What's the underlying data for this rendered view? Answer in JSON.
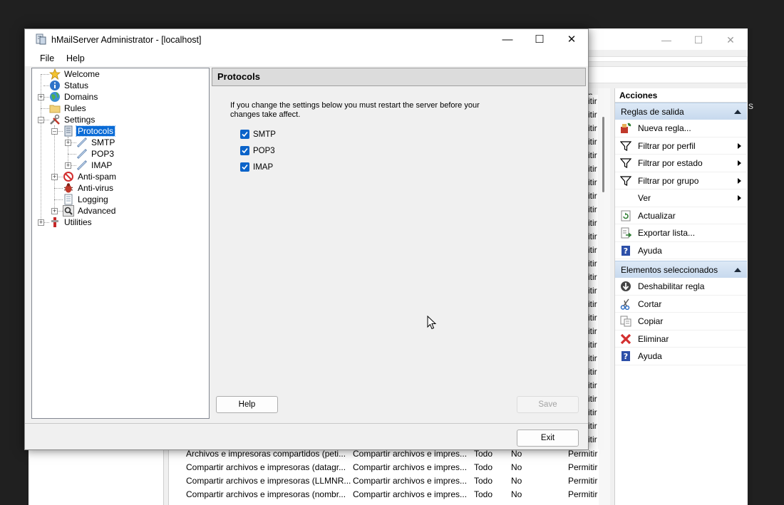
{
  "background_window": {
    "actions_pane": {
      "title": "Acciones",
      "sections": [
        {
          "label": "Reglas de salida",
          "items": [
            {
              "label": "Nueva regla...",
              "icon": "new-rule-icon",
              "submenu": false
            },
            {
              "label": "Filtrar por perfil",
              "icon": "filter-icon",
              "submenu": true
            },
            {
              "label": "Filtrar por estado",
              "icon": "filter-icon",
              "submenu": true
            },
            {
              "label": "Filtrar por grupo",
              "icon": "filter-icon",
              "submenu": true
            },
            {
              "label": "Ver",
              "icon": "",
              "submenu": true
            },
            {
              "label": "Actualizar",
              "icon": "refresh-icon",
              "submenu": false
            },
            {
              "label": "Exportar lista...",
              "icon": "export-icon",
              "submenu": false
            },
            {
              "label": "Ayuda",
              "icon": "help-icon",
              "submenu": false
            }
          ]
        },
        {
          "label": "Elementos seleccionados",
          "items": [
            {
              "label": "Deshabilitar regla",
              "icon": "disable-rule-icon",
              "submenu": false
            },
            {
              "label": "Cortar",
              "icon": "cut-icon",
              "submenu": false
            },
            {
              "label": "Copiar",
              "icon": "copy-icon",
              "submenu": false
            },
            {
              "label": "Eliminar",
              "icon": "delete-icon",
              "submenu": false
            },
            {
              "label": "Ayuda",
              "icon": "help-icon",
              "submenu": false
            }
          ]
        }
      ]
    },
    "column_fragment_header": "n",
    "column_fragment_cells": [
      "itir",
      "itir",
      "itir",
      "itir",
      "itir",
      "itir",
      "itir",
      "itir",
      "itir",
      "itir",
      "itir",
      "itir",
      "itir",
      "itir",
      "itir",
      "itir",
      "itir",
      "itir",
      "itir",
      "itir",
      "itir",
      "itir",
      "itir",
      "itir",
      "itir",
      "itir"
    ],
    "rule_rows": [
      {
        "name": "Archivos e impresoras compartidos (peti...",
        "group": "Compartir archivos e impres...",
        "profile": "Todo",
        "enabled": "No",
        "action": "Permitir"
      },
      {
        "name": "Compartir archivos e impresoras (datagr...",
        "group": "Compartir archivos e impres...",
        "profile": "Todo",
        "enabled": "No",
        "action": "Permitir"
      },
      {
        "name": "Compartir archivos e impresoras (LLMNR...",
        "group": "Compartir archivos e impres...",
        "profile": "Todo",
        "enabled": "No",
        "action": "Permitir"
      },
      {
        "name": "Compartir archivos e impresoras (nombr...",
        "group": "Compartir archivos e impres...",
        "profile": "Todo",
        "enabled": "No",
        "action": "Permitir"
      }
    ],
    "edge_letter": "s"
  },
  "window": {
    "title": "hMailServer Administrator - [localhost]",
    "menu": [
      "File",
      "Help"
    ],
    "tree": {
      "welcome": "Welcome",
      "status": "Status",
      "domains": "Domains",
      "rules": "Rules",
      "settings": "Settings",
      "protocols": "Protocols",
      "smtp": "SMTP",
      "pop3": "POP3",
      "imap": "IMAP",
      "antispam": "Anti-spam",
      "antivirus": "Anti-virus",
      "logging": "Logging",
      "advanced": "Advanced",
      "utilities": "Utilities"
    },
    "panel": {
      "title": "Protocols",
      "info_line1": "If you change the settings below you must restart the server before your",
      "info_line2": "changes take affect.",
      "checkboxes": [
        {
          "label": "SMTP",
          "checked": true
        },
        {
          "label": "POP3",
          "checked": true
        },
        {
          "label": "IMAP",
          "checked": true
        }
      ],
      "help_button": "Help",
      "save_button": "Save"
    },
    "exit_button": "Exit"
  },
  "colors": {
    "selection": "#0a6bd6",
    "checkbox": "#0b63c9",
    "section_header": "#c7d9ee"
  }
}
